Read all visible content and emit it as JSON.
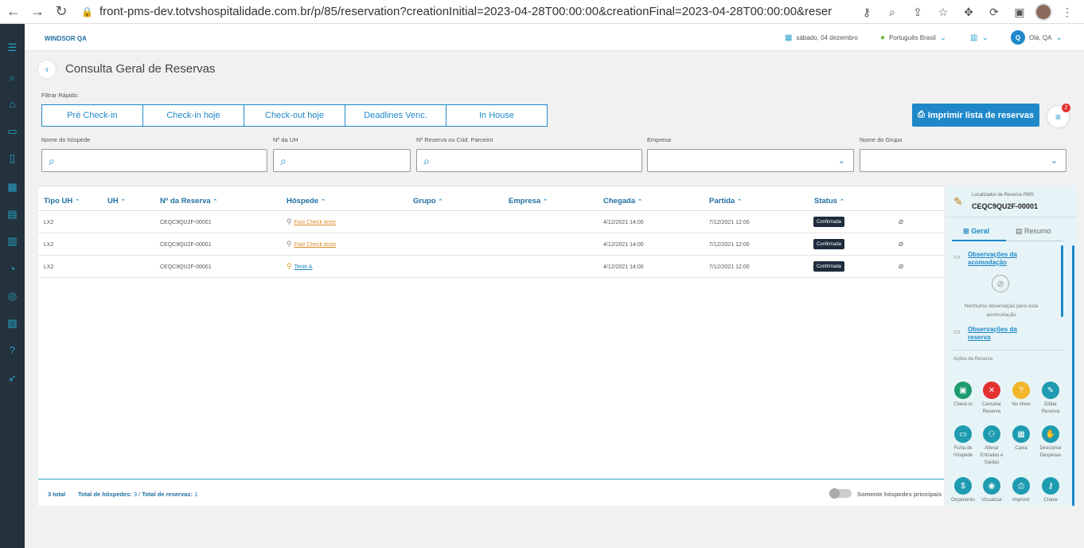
{
  "browser": {
    "url": "front-pms-dev.totvshospitalidade.com.br/p/85/reservation?creationInitial=2023-04-28T00:00:00&creationFinal=2023-04-28T00:00:00&reservationIte..."
  },
  "topbar": {
    "hotel_name": "WINDSOR QA",
    "date": "sábado, 04 dezembro",
    "language": "Português Brasil",
    "user_initial": "Q",
    "greeting": "Olá, QA"
  },
  "page": {
    "title": "Consulta Geral de Reservas",
    "quick_filter_label": "Filtrar Rápido:",
    "quick_filters": [
      "Pré Check-in",
      "Check-in hoje",
      "Check-out hoje",
      "Deadlines Venc.",
      "In House"
    ],
    "print_button": "Imprimir lista de reservas",
    "filter_badge": "2"
  },
  "filters": {
    "guest_name": "Nome do hóspede",
    "uh_number": "Nº da UH",
    "reservation_code": "Nº Reserva ou Cód. Parceiro",
    "company": "Empresa",
    "group_name": "Nome do Grupo"
  },
  "table": {
    "headers": [
      "Tipo UH",
      "UH",
      "Nº da Reserva",
      "Hóspede",
      "Grupo",
      "Empresa",
      "Chegada",
      "Partida",
      "Status"
    ],
    "rows": [
      {
        "tipo": "LX2",
        "uh": "",
        "reserva": "CEQC9QU2F-00001",
        "hospede": "Fast Check teste",
        "grupo": "",
        "empresa": "",
        "chegada": "4/12/2021 14:00",
        "partida": "7/12/2021 12:00",
        "status": "Confirmada"
      },
      {
        "tipo": "LX2",
        "uh": "",
        "reserva": "CEQC9QU2F-00001",
        "hospede": "Fast Check teste",
        "grupo": "",
        "empresa": "",
        "chegada": "4/12/2021 14:00",
        "partida": "7/12/2021 12:00",
        "status": "Confirmada"
      },
      {
        "tipo": "LX2",
        "uh": "",
        "reserva": "CEQC9QU2F-00001",
        "hospede": "Teste A",
        "grupo": "",
        "empresa": "",
        "chegada": "4/12/2021 14:00",
        "partida": "7/12/2021 12:00",
        "status": "Confirmada"
      }
    ],
    "footer": {
      "total": "3 total",
      "guests_label": "Total de hóspedes:",
      "guests_value": "3",
      "reservations_label": "Total de reservas:",
      "reservations_value": "1",
      "toggle_label": "Somente hóspedes principais"
    }
  },
  "panel": {
    "locator_label": "Localizador de Reserva PMS",
    "locator_code": "CEQC9QU2F-00001",
    "tabs": [
      "Geral",
      "Resumo"
    ],
    "obs_room": "Observações da acomodação",
    "empty_room": "Nenhuma observação para esta acomodação",
    "obs_reservation": "Observações da reserva",
    "actions_label": "Ações da Reserva",
    "actions": [
      {
        "label": "Check-in",
        "icon": "calendar-check-icon",
        "color": "#1e9b6e"
      },
      {
        "label": "Cancelar Reserva",
        "icon": "cancel-icon",
        "color": "#e3312f"
      },
      {
        "label": "No show",
        "icon": "question-icon",
        "color": "#f2b62a"
      },
      {
        "label": "Editar Reserva",
        "icon": "pencil-icon",
        "color": "#1e9bb0"
      },
      {
        "label": "Ficha de Hóspede",
        "icon": "folder-icon",
        "color": "#1e9bb0"
      },
      {
        "label": "Alterar Entradas e Saídas",
        "icon": "users-icon",
        "color": "#1e9bb0"
      },
      {
        "label": "Caixa",
        "icon": "calculator-icon",
        "color": "#1e9bb0"
      },
      {
        "label": "Direcionar Despesas",
        "icon": "hand-icon",
        "color": "#1e9bb0"
      },
      {
        "label": "Orçamento",
        "icon": "dollar-icon",
        "color": "#1e9bb0"
      },
      {
        "label": "Visualizar",
        "icon": "eye-icon",
        "color": "#1e9bb0"
      },
      {
        "label": "Imprimir",
        "icon": "printer-icon",
        "color": "#1e9bb0"
      },
      {
        "label": "Chave",
        "icon": "key-icon",
        "color": "#1e9bb0"
      }
    ]
  }
}
